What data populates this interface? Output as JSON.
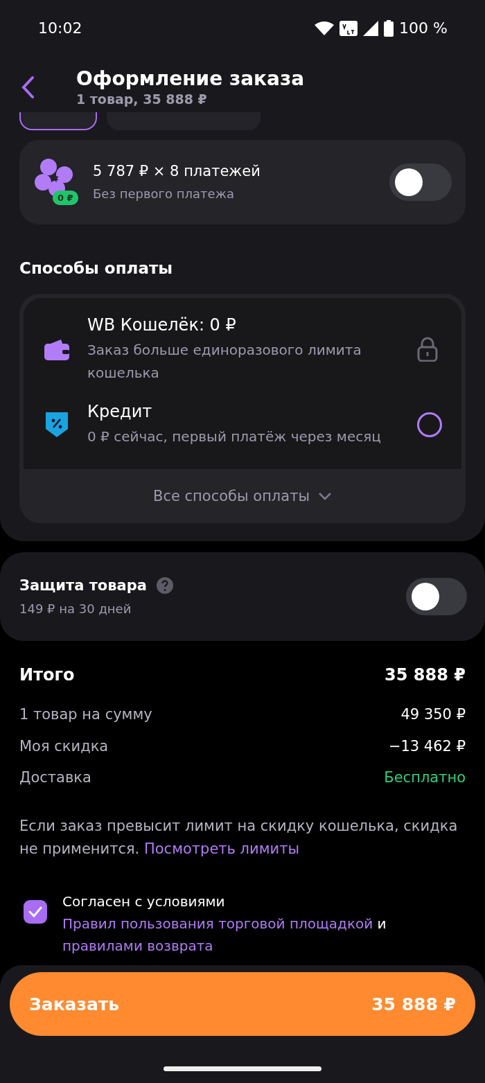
{
  "status_bar": {
    "time": "10:02",
    "battery": "100 %"
  },
  "header": {
    "title": "Оформление заказа",
    "subtitle": "1 товар, 35 888 ₽"
  },
  "payment_timing": [
    {
      "selected": true
    },
    {
      "selected": false
    }
  ],
  "installment": {
    "title": "5 787 ₽ × 8 платежей",
    "subtitle": "Без первого платежа",
    "badge": "0 ₽",
    "on": false
  },
  "payment_methods": {
    "heading": "Способы оплаты",
    "items": [
      {
        "kind": "locked",
        "title": "WB Кошелёк: 0 ₽",
        "subtitle": "Заказ больше единоразового лимита кошелька",
        "selected": false
      },
      {
        "kind": "radio",
        "title": "Кредит",
        "subtitle": "0 ₽ сейчас, первый платёж через месяц",
        "selected": false
      }
    ],
    "more": "Все способы оплаты"
  },
  "protection": {
    "title": "Защита товара",
    "subtitle": "149 ₽ на 30 дней",
    "on": false
  },
  "summary": {
    "title": "Итого",
    "total": "35 888 ₽",
    "rows": [
      {
        "label": "1 товар на сумму",
        "value": "49 350 ₽",
        "color": "#ffffff"
      },
      {
        "label": "Моя скидка",
        "value": "−13 462 ₽",
        "color": "#ffffff"
      },
      {
        "label": "Доставка",
        "value": "Бесплатно",
        "color": "#2fcf7a"
      }
    ]
  },
  "note": {
    "text": "Если заказ превысит лимит на скидку кошелька, скидка не применится.",
    "link": "Посмотреть лимиты"
  },
  "agreement": {
    "checked": true,
    "parts": [
      {
        "text": "Согласен с условиями",
        "link": false
      },
      {
        "text": "Правил пользования торговой площадкой",
        "link": true
      },
      {
        "text": "и",
        "link": false
      },
      {
        "text": "правилами возврата",
        "link": true
      }
    ]
  },
  "order_button": {
    "label": "Заказать",
    "amount": "35 888 ₽"
  }
}
